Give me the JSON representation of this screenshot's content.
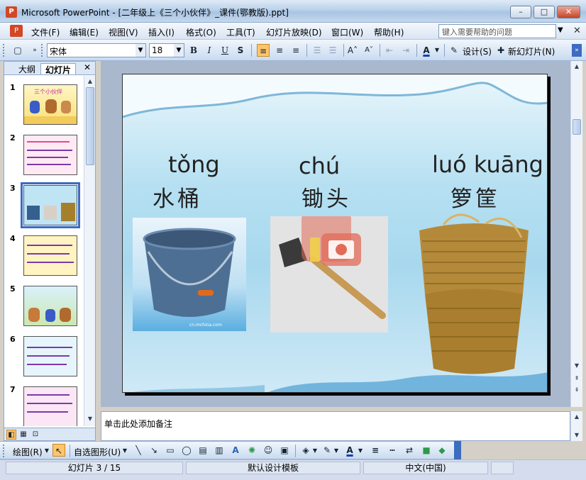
{
  "window": {
    "title": "Microsoft PowerPoint - [二年级上《三个小伙伴》_课件(鄂教版).ppt]",
    "app_icon": "powerpoint-icon",
    "minimize": "–",
    "maximize": "□",
    "close": "✕"
  },
  "menu": {
    "items": [
      "文件(F)",
      "编辑(E)",
      "视图(V)",
      "插入(I)",
      "格式(O)",
      "工具(T)",
      "幻灯片放映(D)",
      "窗口(W)",
      "帮助(H)"
    ],
    "help_placeholder": "键入需要帮助的问题"
  },
  "toolbar": {
    "font_name": "宋体",
    "font_size": "18",
    "design_label": "设计(S)",
    "new_slide_label": "新幻灯片(N)",
    "accent_color": "#ffc56b"
  },
  "left_pane": {
    "tabs": [
      "大纲",
      "幻灯片"
    ],
    "active_tab": "幻灯片",
    "close": "✕",
    "slides": [
      {
        "num": "1",
        "title": "三个小伙伴"
      },
      {
        "num": "2"
      },
      {
        "num": "3",
        "selected": true
      },
      {
        "num": "4"
      },
      {
        "num": "5"
      },
      {
        "num": "6"
      },
      {
        "num": "7"
      }
    ]
  },
  "slide": {
    "items": [
      {
        "pinyin": "tǒng",
        "hanzi": "水桶"
      },
      {
        "pinyin": "chú",
        "hanzi": "锄头"
      },
      {
        "pinyin": "luó kuāng",
        "hanzi": "箩筐"
      }
    ],
    "watermark": "cn.mchina.com"
  },
  "notes": {
    "placeholder": "单击此处添加备注"
  },
  "drawbar": {
    "draw_label": "绘图(R)",
    "autoshape_label": "自选图形(U)"
  },
  "status": {
    "slide_pos": "幻灯片 3 / 15",
    "template": "默认设计模板",
    "language": "中文(中国)"
  }
}
